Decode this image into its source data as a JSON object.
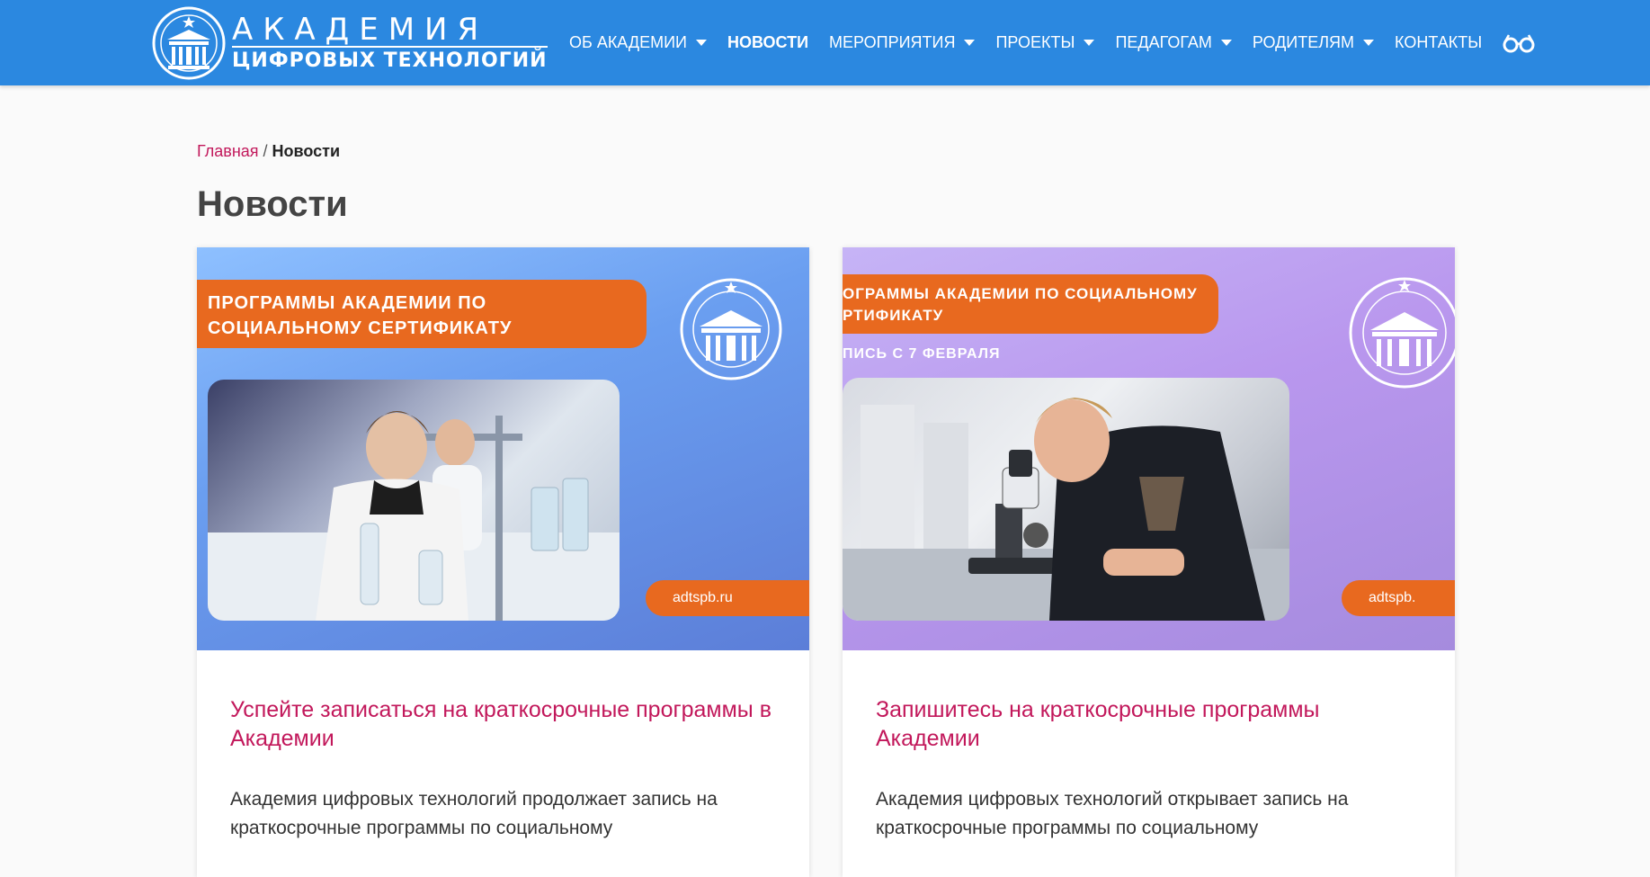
{
  "header": {
    "logo": {
      "line1": "АКАДЕМИЯ",
      "line2": "ЦИФРОВЫХ ТЕХНОЛОГИЙ"
    },
    "nav": [
      {
        "label": "ОБ АКАДЕМИИ",
        "dropdown": true
      },
      {
        "label": "НОВОСТИ",
        "dropdown": false,
        "active": true
      },
      {
        "label": "МЕРОПРИЯТИЯ",
        "dropdown": true
      },
      {
        "label": "ПРОЕКТЫ",
        "dropdown": true
      },
      {
        "label": "ПЕДАГОГАМ",
        "dropdown": true
      },
      {
        "label": "РОДИТЕЛЯМ",
        "dropdown": true
      },
      {
        "label": "КОНТАКТЫ",
        "dropdown": false
      }
    ],
    "accessibility_icon": "glasses-icon"
  },
  "breadcrumb": {
    "home": "Главная",
    "separator": "/",
    "current": "Новости"
  },
  "page_title": "Новости",
  "cards": [
    {
      "banner_text": "ПРОГРАММЫ АКАДЕМИИ ПО СОЦИАЛЬНОМУ СЕРТИФИКАТУ",
      "banner_sub": "",
      "url_text": "adtspb.ru",
      "title": "Успейте записаться на краткосрочные программы в Академии",
      "excerpt": "Академия цифровых технологий продолжает запись на краткосрочные программы по социальному"
    },
    {
      "banner_text": "ОГРАММЫ АКАДЕМИИ ПО СОЦИАЛЬНОМУ РТИФИКАТУ",
      "banner_sub": "ПИСЬ С 7 ФЕВРАЛЯ",
      "url_text": "adtspb.",
      "title": "Запишитесь на краткосрочные программы Академии",
      "excerpt": "Академия цифровых технологий открывает запись на краткосрочные программы по социальному"
    }
  ],
  "colors": {
    "header_bg": "#2b88e0",
    "accent_pink": "#c2185b",
    "banner_orange": "#e8691f"
  }
}
